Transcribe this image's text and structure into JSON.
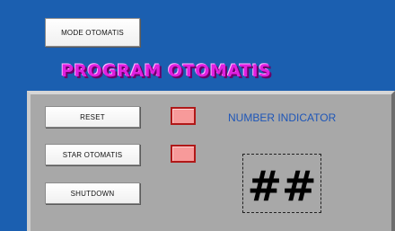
{
  "buttons": {
    "mode": "MODE OTOMATIS",
    "reset": "RESET",
    "star": "STAR OTOMATIS",
    "shutdown": "SHUTDOWN"
  },
  "title": "PROGRAM OTOMATIS",
  "indicator": {
    "label": "NUMBER INDICATOR",
    "value": "##"
  },
  "colors": {
    "background": "#1b5fb0",
    "title": "#e020e0",
    "panel": "#a8a8a8",
    "led_fill": "#f79a9a",
    "led_border": "#b01818",
    "indicator_label": "#1e56b8"
  }
}
